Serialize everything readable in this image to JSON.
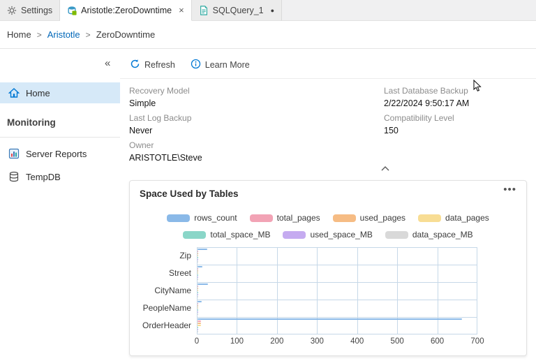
{
  "window": {
    "tabs": [
      {
        "label": "Settings"
      },
      {
        "label": "Aristotle:ZeroDowntime",
        "close_glyph": "×"
      },
      {
        "label": "SQLQuery_1",
        "dirty_glyph": "●"
      }
    ]
  },
  "breadcrumb": {
    "items": [
      "Home",
      "Aristotle",
      "ZeroDowntime"
    ],
    "separator": ">"
  },
  "sidebar": {
    "collapse_glyph": "«",
    "section_label": "Monitoring",
    "items": [
      {
        "label": "Home"
      },
      {
        "label": "Server Reports"
      },
      {
        "label": "TempDB"
      }
    ]
  },
  "toolbar": {
    "refresh_label": "Refresh",
    "learn_more_label": "Learn More"
  },
  "properties": {
    "fields": [
      {
        "label": "Recovery Model",
        "value": "Simple"
      },
      {
        "label": "Last Database Backup",
        "value": "2/22/2024 9:50:17 AM"
      },
      {
        "label": "Last Log Backup",
        "value": "Never"
      },
      {
        "label": "Compatibility Level",
        "value": "150"
      },
      {
        "label": "Owner",
        "value": "ARISTOTLE\\Steve"
      }
    ]
  },
  "card": {
    "title": "Space Used by Tables",
    "menu_glyph": "•••"
  },
  "chart_data": {
    "type": "bar",
    "orientation": "horizontal",
    "title": "Space Used by Tables",
    "categories": [
      "Zip",
      "Street",
      "CityName",
      "PeopleName",
      "OrderHeader"
    ],
    "series": [
      {
        "name": "rows_count",
        "color": "#8ab9e8",
        "values": [
          24,
          12,
          26,
          10,
          660
        ]
      },
      {
        "name": "total_pages",
        "color": "#f2a3b5",
        "values": [
          2,
          1,
          2,
          1,
          9
        ]
      },
      {
        "name": "used_pages",
        "color": "#f6bc84",
        "values": [
          2,
          1,
          2,
          1,
          9
        ]
      },
      {
        "name": "data_pages",
        "color": "#f8dd94",
        "values": [
          1,
          1,
          1,
          1,
          8
        ]
      },
      {
        "name": "total_space_MB",
        "color": "#8ad6c8",
        "values": [
          0.2,
          0.1,
          0.2,
          0.1,
          0.1
        ]
      },
      {
        "name": "used_space_MB",
        "color": "#c5abf0",
        "values": [
          0.2,
          0.1,
          0.2,
          0.1,
          0.1
        ]
      },
      {
        "name": "data_space_MB",
        "color": "#d9d9d9",
        "values": [
          0.1,
          0.1,
          0.1,
          0.1,
          0.1
        ]
      }
    ],
    "xlim": [
      0,
      700
    ],
    "x_ticks": [
      0,
      100,
      200,
      300,
      400,
      500,
      600,
      700
    ],
    "grid": true,
    "legend_position": "top"
  },
  "colors": {
    "accent": "#0078d4",
    "link": "#0067b8",
    "active_item_bg": "#d6e9f8"
  }
}
